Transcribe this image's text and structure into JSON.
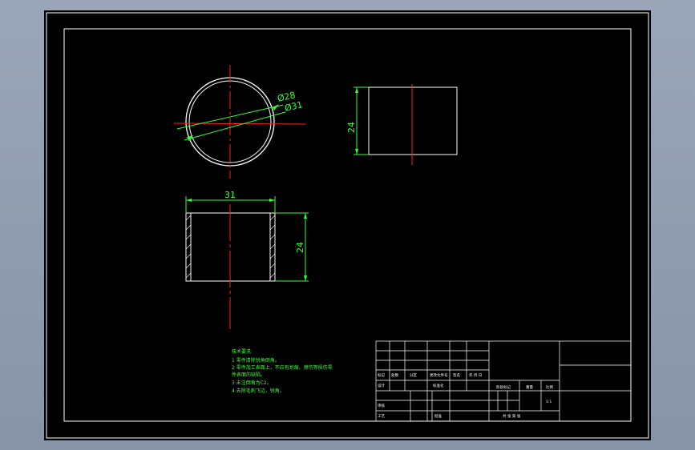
{
  "drawing": {
    "dimensions": {
      "inner_diameter": "Ø28",
      "outer_diameter": "Ø31",
      "side_height": "24",
      "front_width": "31",
      "front_height": "24"
    },
    "tech_notes": {
      "title": "技术要求",
      "lines": [
        "1 零件清除锐角倒角。",
        "2 零件加工表面上，不应有划痕、擦伤等损伤零",
        "件表面的缺陷。",
        "3 未注倒角为C2。",
        "4 去除毛刺飞边，锐角。"
      ]
    },
    "title_block": {
      "row_labels_1": [
        "标记",
        "处数",
        "分区",
        "更改文件号",
        "签名",
        "年 月 日"
      ],
      "designer": "设计",
      "standardization": "标准化",
      "checker": "审核",
      "process": "工艺",
      "approve": "批准",
      "stage_labels": "阶段标记",
      "weight": "重量",
      "scale": "比例",
      "scale_value": "1:1",
      "sheets": "共  张  第  张"
    }
  },
  "colors": {
    "frame": "#ffffff",
    "center_line": "#ff2020",
    "dimension": "#33ff33",
    "background": "#000000"
  }
}
